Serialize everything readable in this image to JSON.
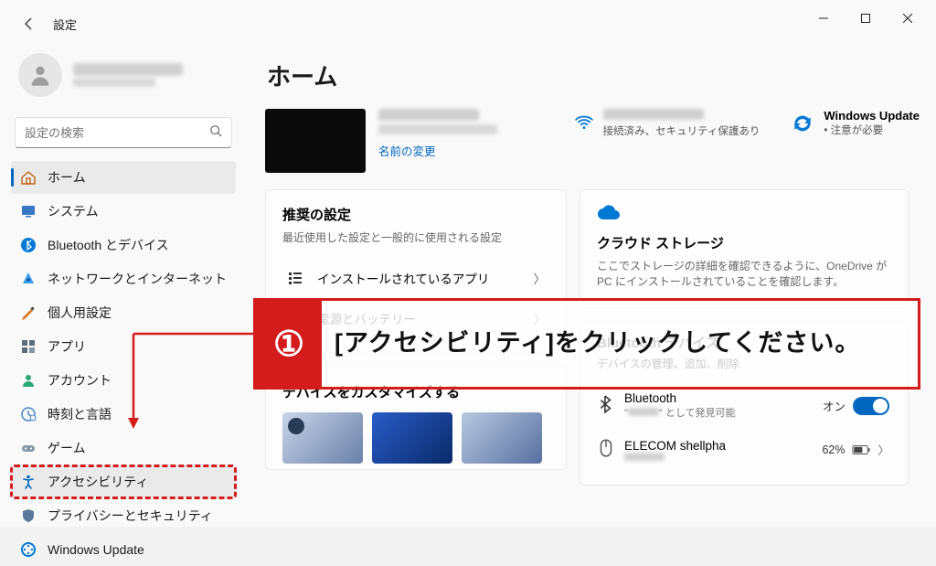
{
  "window": {
    "app_title": "設定"
  },
  "sidebar": {
    "search_placeholder": "設定の検索",
    "items": [
      {
        "label": "ホーム"
      },
      {
        "label": "システム"
      },
      {
        "label": "Bluetooth とデバイス"
      },
      {
        "label": "ネットワークとインターネット"
      },
      {
        "label": "個人用設定"
      },
      {
        "label": "アプリ"
      },
      {
        "label": "アカウント"
      },
      {
        "label": "時刻と言語"
      },
      {
        "label": "ゲーム"
      },
      {
        "label": "アクセシビリティ"
      },
      {
        "label": "プライバシーとセキュリティ"
      },
      {
        "label": "Windows Update"
      }
    ]
  },
  "main": {
    "page_title": "ホーム",
    "rename_link": "名前の変更",
    "wifi_status": "接続済み、セキュリティ保護あり",
    "windows_update": {
      "title": "Windows Update",
      "status": "• 注意が必要"
    },
    "recommended": {
      "title": "推奨の設定",
      "subtitle": "最近使用した設定と一般的に使用される設定",
      "rows": [
        {
          "label": "インストールされているアプリ"
        },
        {
          "label": "電源とバッテリー"
        }
      ]
    },
    "customize_title": "デバイスをカスタマイズする",
    "cloud": {
      "title": "クラウド ストレージ",
      "subtitle": "ここでストレージの詳細を確認できるように、OneDrive が PC にインストールされていることを確認します。"
    },
    "bt_section": {
      "title": "Bluetooth デバイス",
      "subtitle": "デバイスの管理、追加、削除",
      "bt_row": {
        "name": "Bluetooth",
        "sub_prefix": "\"",
        "sub_suffix": "\" として発見可能",
        "state": "オン"
      },
      "device_row": {
        "name": "ELECOM shellpha",
        "battery": "62%"
      }
    }
  },
  "annotation": {
    "number": "①",
    "text": "[アクセシビリティ]をクリックしてください。"
  }
}
